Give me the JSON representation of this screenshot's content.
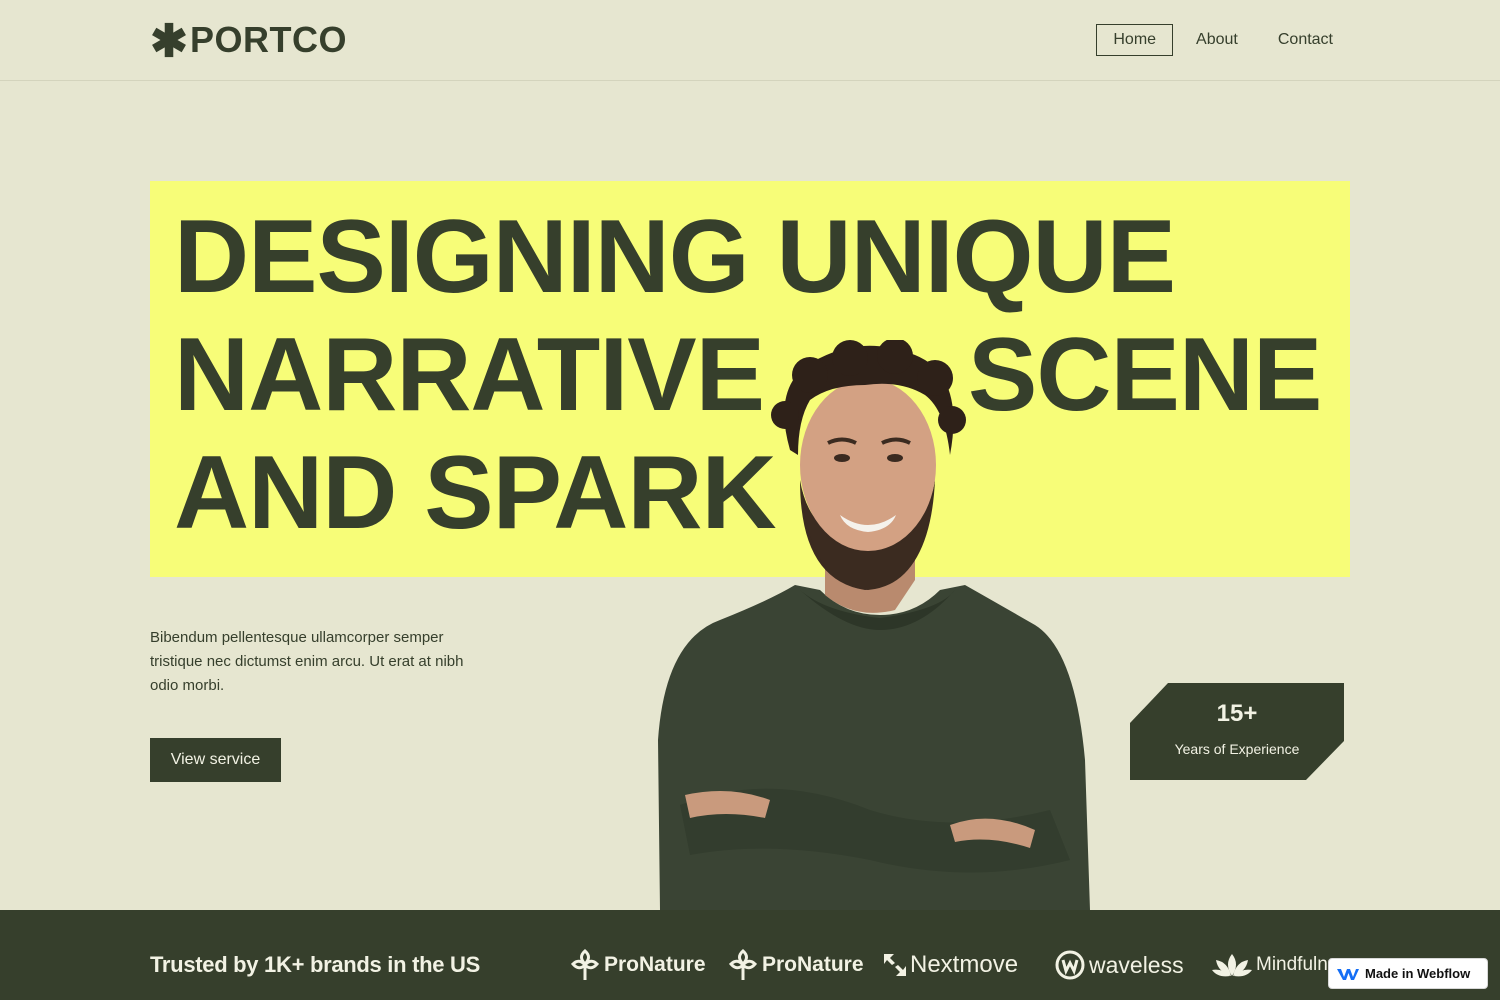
{
  "nav": {
    "logo": "PORTCO",
    "links": [
      {
        "label": "Home",
        "active": true
      },
      {
        "label": "About",
        "active": false
      },
      {
        "label": "Contact",
        "active": false
      }
    ]
  },
  "hero": {
    "headline": {
      "line1": "DESIGNING UNIQUE",
      "line2_left": "NARRATIVE",
      "line2_right": "SCENE",
      "line3": "AND SPARK"
    },
    "intro": "Bibendum pellentesque ullamcorper semper tristique nec dictumst enim arcu. Ut erat at nibh odio morbi.",
    "cta_label": "View service",
    "badge": {
      "value": "15+",
      "label": "Years of Experience"
    }
  },
  "trusted": {
    "heading": "Trusted by 1K+ brands in the US",
    "brands": [
      "ProNature",
      "ProNature",
      "Nextmove",
      "waveless",
      "Mindfulness"
    ]
  },
  "webflow_badge": "Made in Webflow",
  "colors": {
    "background": "#e6e6d0",
    "accent_yellow": "#f7fd78",
    "dark_green": "#363f2c",
    "text_light": "#f2f2e4"
  }
}
